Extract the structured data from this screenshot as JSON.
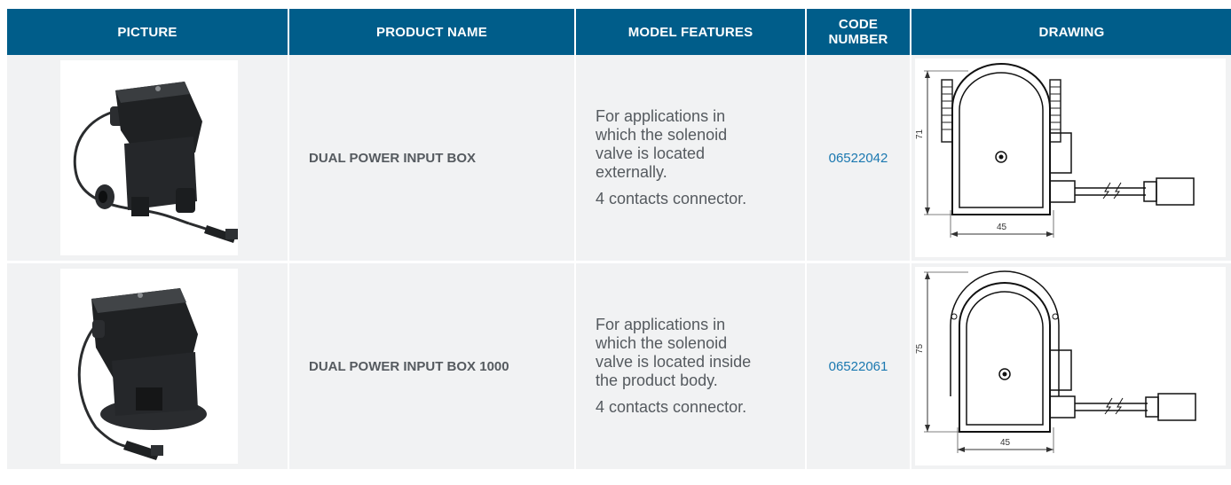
{
  "headers": {
    "picture": "PICTURE",
    "product_name": "PRODUCT NAME",
    "model_features": "MODEL FEATURES",
    "code_number_line1": "CODE",
    "code_number_line2": "NUMBER",
    "drawing": "DRAWING"
  },
  "rows": [
    {
      "product_name": "DUAL POWER INPUT BOX",
      "features_line1": "For applications in",
      "features_line2": "which the solenoid",
      "features_line3": "valve is located",
      "features_line4": "externally.",
      "features_note": "4 contacts connector.",
      "code": "06522042",
      "dim_height": "71",
      "dim_width": "45"
    },
    {
      "product_name": "DUAL POWER INPUT BOX 1000",
      "features_line1": "For applications in",
      "features_line2": "which the solenoid",
      "features_line3": "valve is located inside",
      "features_line4": "the product body.",
      "features_note": "4 contacts connector.",
      "code": "06522061",
      "dim_height": "75",
      "dim_width": "45"
    }
  ]
}
